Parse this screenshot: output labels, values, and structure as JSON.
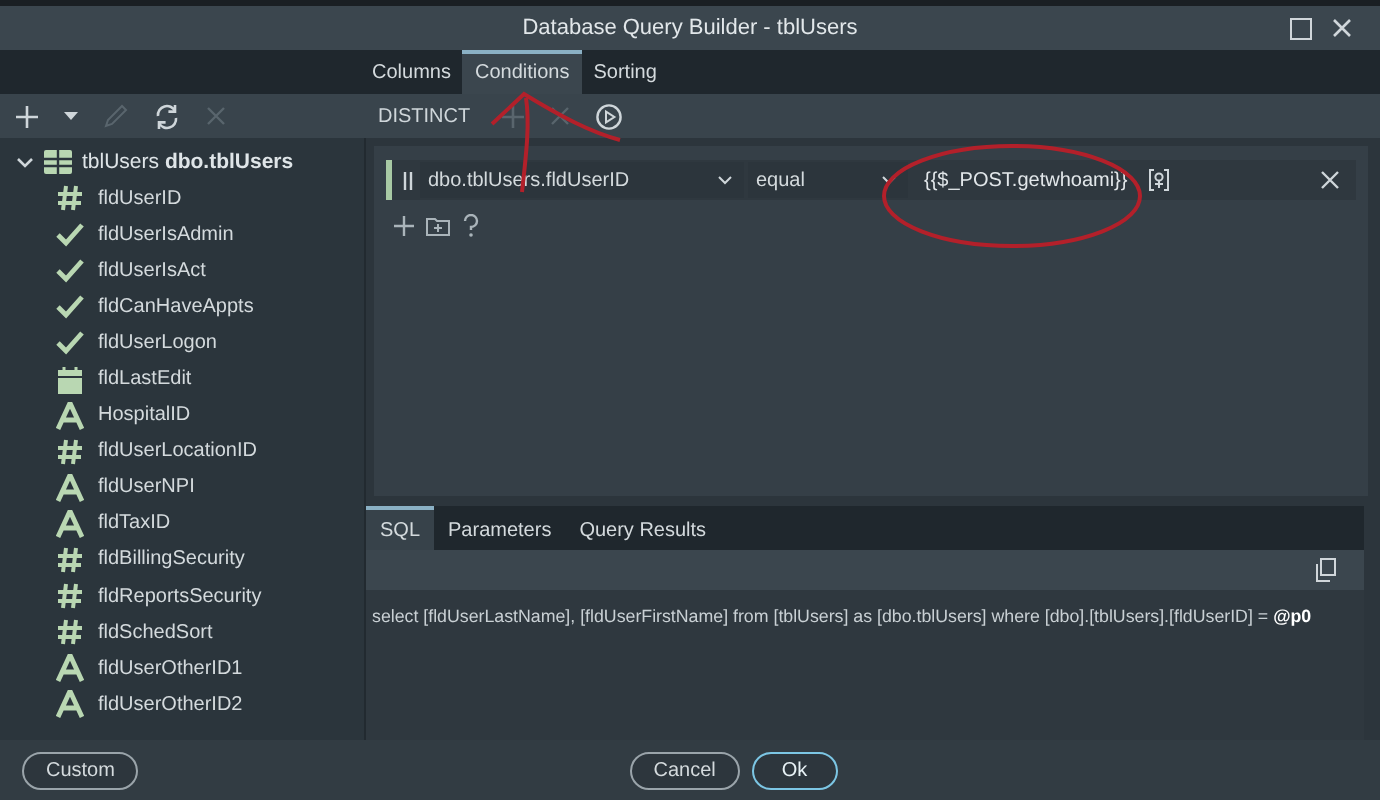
{
  "window": {
    "title": "Database Query Builder - tblUsers"
  },
  "tabs": [
    {
      "label": "Columns",
      "selected": false
    },
    {
      "label": "Conditions",
      "selected": true
    },
    {
      "label": "Sorting",
      "selected": false
    }
  ],
  "toolbar": [
    {
      "kind": "plus",
      "disabled": false
    },
    {
      "kind": "caret",
      "disabled": false
    },
    {
      "kind": "pencil",
      "disabled": true
    },
    {
      "kind": "refresh",
      "disabled": false
    },
    {
      "kind": "close",
      "disabled": true
    },
    {
      "kind": "text",
      "label": "DISTINCT",
      "disabled": false
    },
    {
      "kind": "plus",
      "disabled": true
    },
    {
      "kind": "close",
      "disabled": true
    },
    {
      "kind": "play",
      "disabled": false
    }
  ],
  "tree": {
    "table": "tblUsers",
    "schema": "dbo.tblUsers",
    "expanded": true,
    "children": [
      {
        "name": "fldUserID",
        "kind": "number"
      },
      {
        "name": "fldUserIsAdmin",
        "kind": "boolean"
      },
      {
        "name": "fldUserIsAct",
        "kind": "boolean"
      },
      {
        "name": "fldCanHaveAppts",
        "kind": "boolean"
      },
      {
        "name": "fldUserLogon",
        "kind": "boolean"
      },
      {
        "name": "fldLastEdit",
        "kind": "date"
      },
      {
        "name": "HospitalID",
        "kind": "text"
      },
      {
        "name": "fldUserLocationID",
        "kind": "number"
      },
      {
        "name": "fldUserNPI",
        "kind": "text"
      },
      {
        "name": "fldTaxID",
        "kind": "text"
      },
      {
        "name": "fldBillingSecurity",
        "kind": "number"
      },
      {
        "name": "fldReportsSecurity",
        "kind": "number"
      },
      {
        "name": "fldSchedSort",
        "kind": "number"
      },
      {
        "name": "fldUserOtherID1",
        "kind": "text"
      },
      {
        "name": "fldUserOtherID2",
        "kind": "text"
      }
    ]
  },
  "condition": {
    "field": "dbo.tblUsers.fldUserID",
    "operator": "equal",
    "value": "{{$_POST.getwhoami}}"
  },
  "bottom_tabs": [
    {
      "label": "SQL",
      "selected": true
    },
    {
      "label": "Parameters",
      "selected": false
    },
    {
      "label": "Query Results",
      "selected": false
    }
  ],
  "sql": "select [fldUserLastName], [fldUserFirstName] from [tblUsers] as [dbo.tblUsers] where [dbo].[tblUsers].[fldUserID] = **@p0**",
  "buttons": {
    "custom": "Custom",
    "cancel": "Cancel",
    "ok": "Ok"
  }
}
